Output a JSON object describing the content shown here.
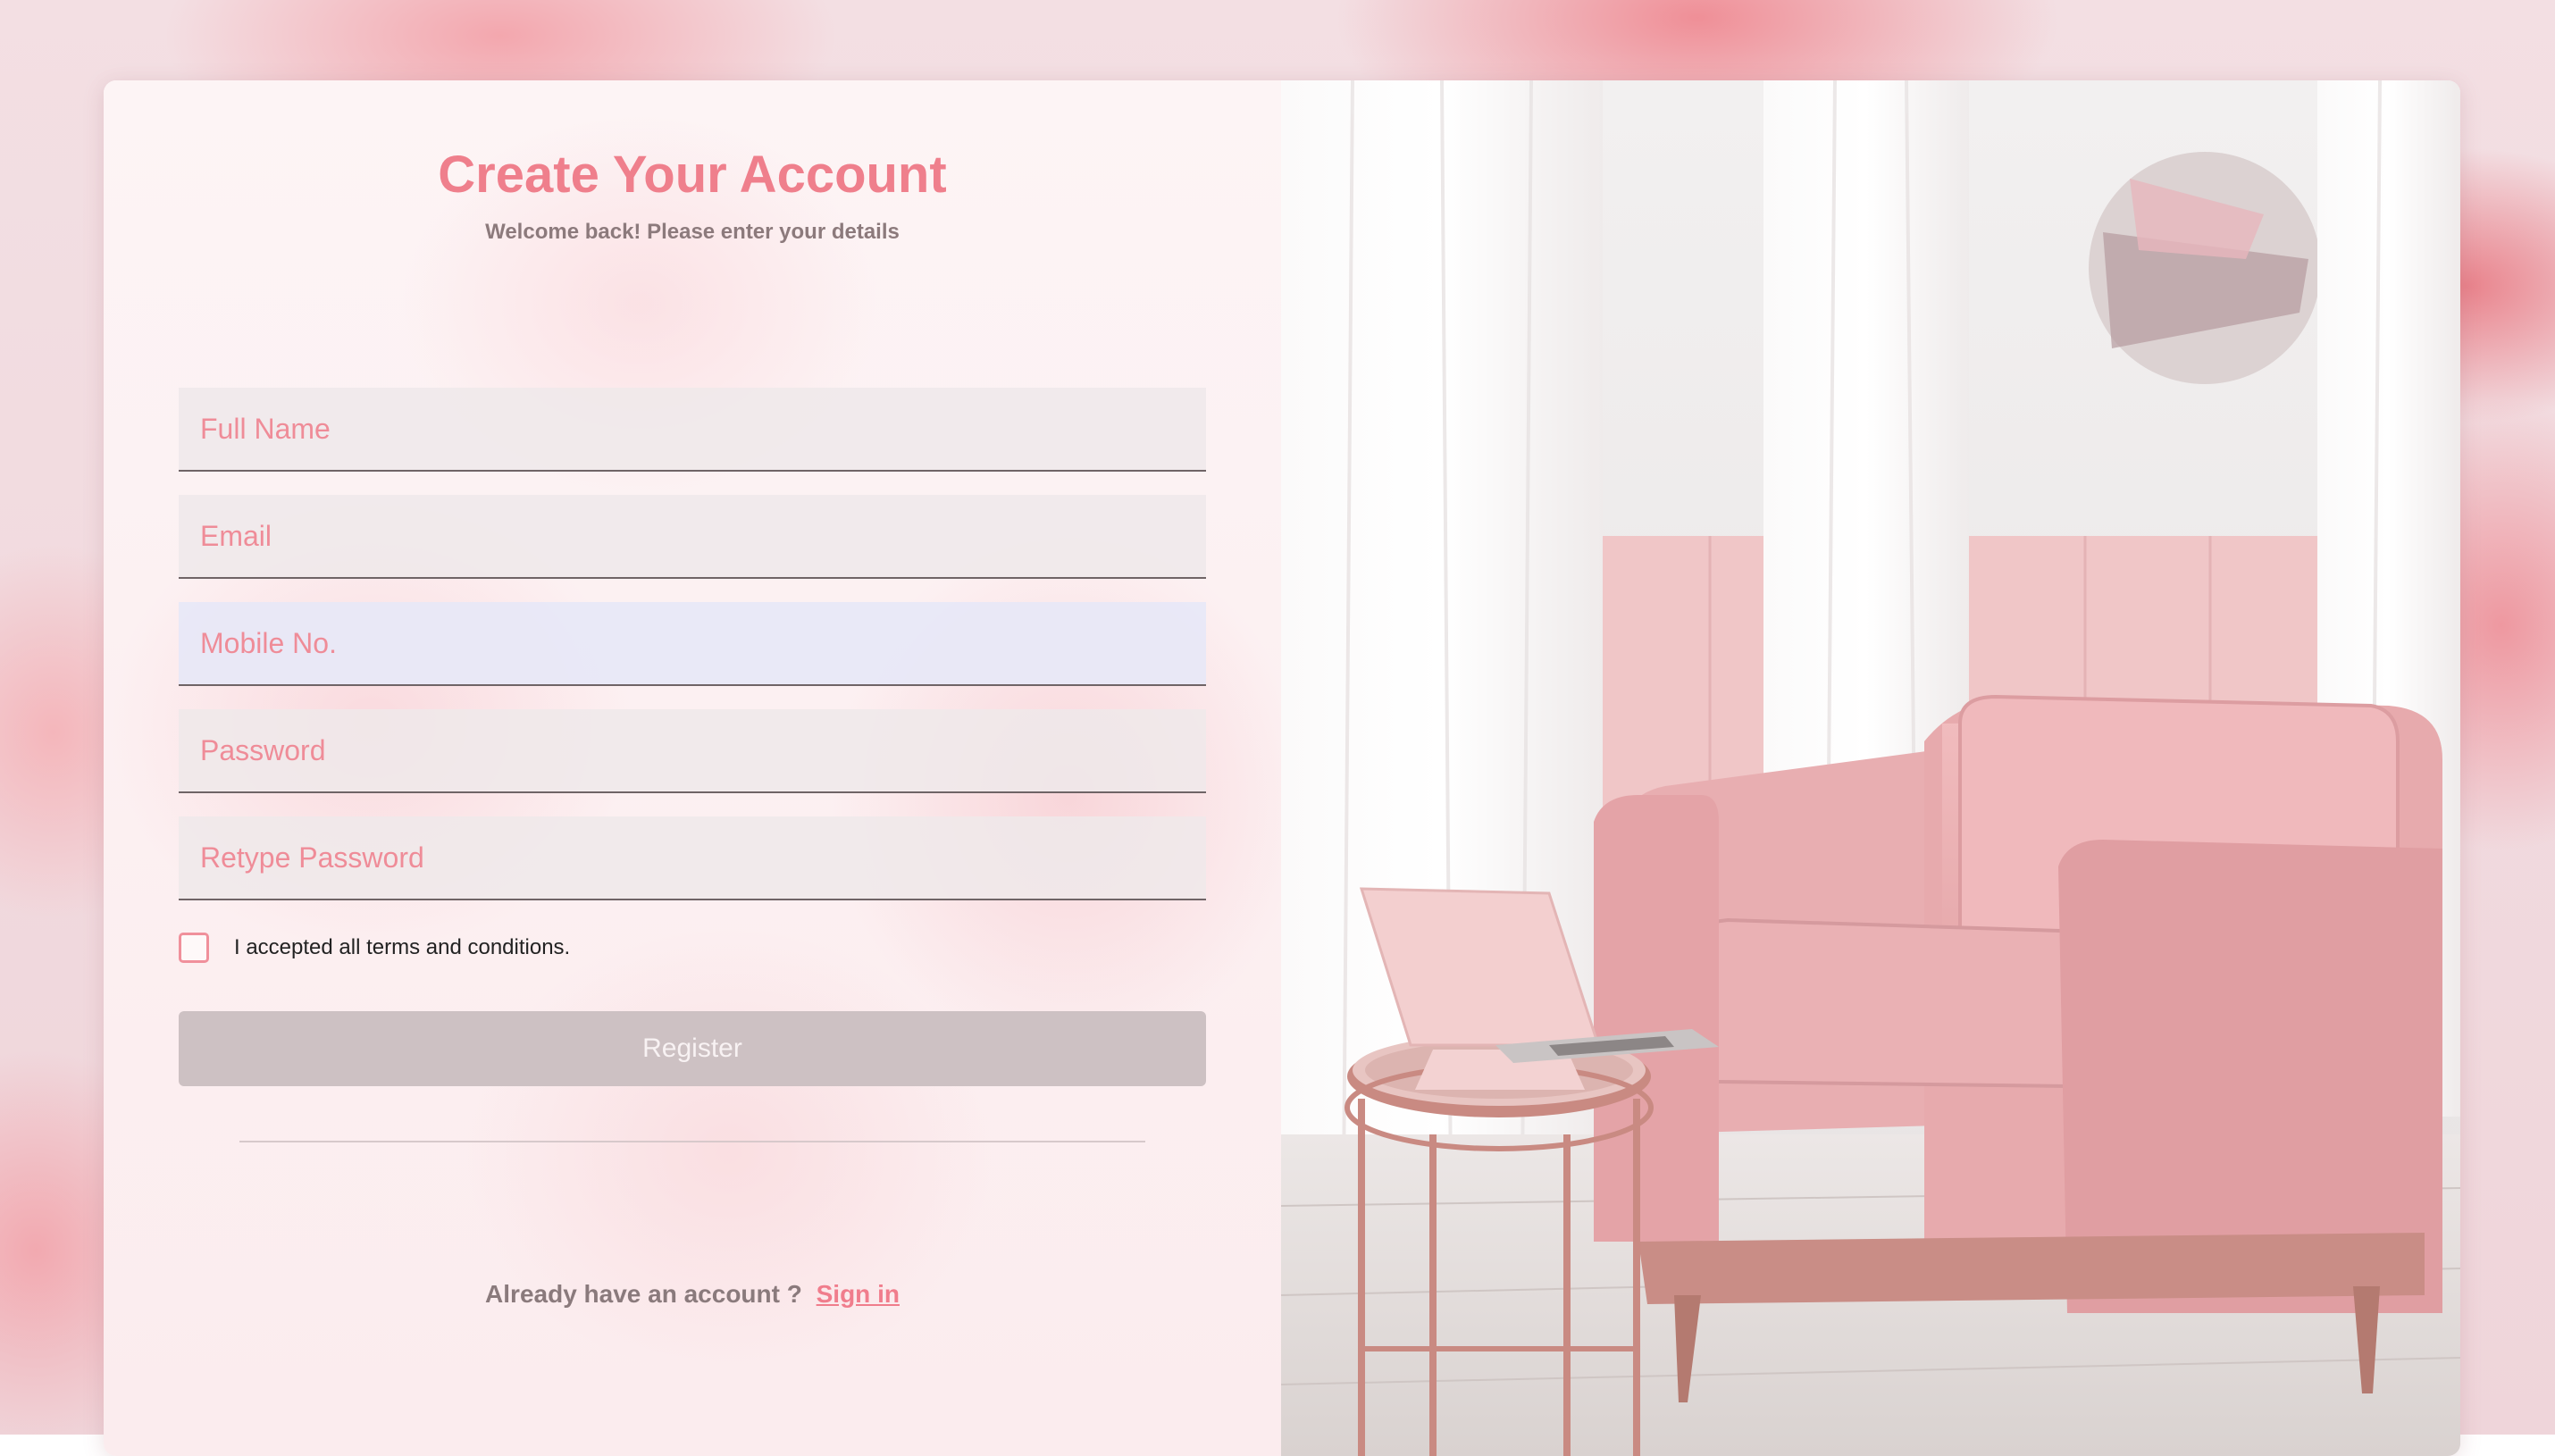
{
  "header": {
    "title": "Create Your Account",
    "subtitle": "Welcome back! Please enter your details"
  },
  "form": {
    "fields": [
      {
        "placeholder": "Full Name",
        "value": ""
      },
      {
        "placeholder": "Email",
        "value": ""
      },
      {
        "placeholder": "Mobile No.",
        "value": ""
      },
      {
        "placeholder": "Password",
        "value": ""
      },
      {
        "placeholder": "Retype Password",
        "value": ""
      }
    ],
    "terms_label": "I accepted all terms and conditions.",
    "terms_checked": false,
    "register_label": "Register"
  },
  "footer": {
    "prompt": "Already have an account ?",
    "signin_label": "Sign in"
  },
  "colors": {
    "accent": "#ef7f8c",
    "button": "#cdc1c3",
    "muted_text": "#8c7a7c"
  },
  "illustration": {
    "subject": "pink armchair with laptop on rose-gold side table"
  }
}
